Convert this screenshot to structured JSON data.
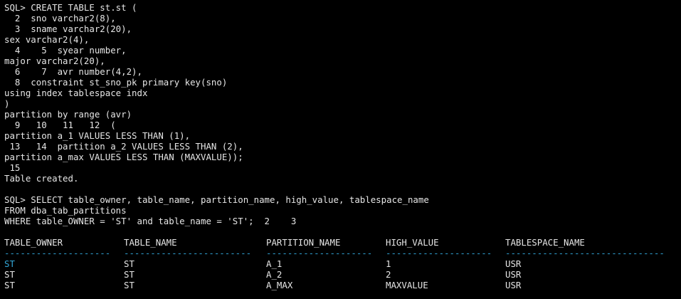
{
  "terminal": {
    "lines": [
      "SQL> CREATE TABLE st.st (",
      "  2  sno varchar2(8),",
      "  3  sname varchar2(20),",
      "sex varchar2(4),",
      "  4    5  syear number,",
      "major varchar2(20),",
      "  6    7  avr number(4,2),",
      "  8  constraint st_sno_pk primary key(sno)",
      "using index tablespace indx",
      ")",
      "partition by range (avr)",
      "  9   10   11   12  (",
      "partition a_1 VALUES LESS THAN (1),",
      " 13   14  partition a_2 VALUES LESS THAN (2),",
      "partition a_max VALUES LESS THAN (MAXVALUE));",
      " 15",
      "Table created.",
      "",
      "SQL> SELECT table_owner, table_name, partition_name, high_value, tablespace_name",
      "FROM dba_tab_partitions",
      "WHERE table_OWNER = 'ST' and table_name = 'ST';  2    3"
    ],
    "result": {
      "headers": [
        "TABLE_OWNER",
        "TABLE_NAME",
        "PARTITION_NAME",
        "HIGH_VALUE",
        "TABLESPACE_NAME"
      ],
      "separators": [
        "--------------------",
        "------------------------",
        "--------------------",
        "--------------------",
        "------------------------------"
      ],
      "rows": [
        [
          "ST",
          "ST",
          "A_1",
          "1",
          "USR"
        ],
        [
          "ST",
          "ST",
          "A_2",
          "2",
          "USR"
        ],
        [
          "ST",
          "ST",
          "A_MAX",
          "MAXVALUE",
          "USR"
        ]
      ]
    },
    "colors": {
      "background": "#000000",
      "foreground": "#e6e6e6",
      "accent": "#33a7d8"
    }
  }
}
